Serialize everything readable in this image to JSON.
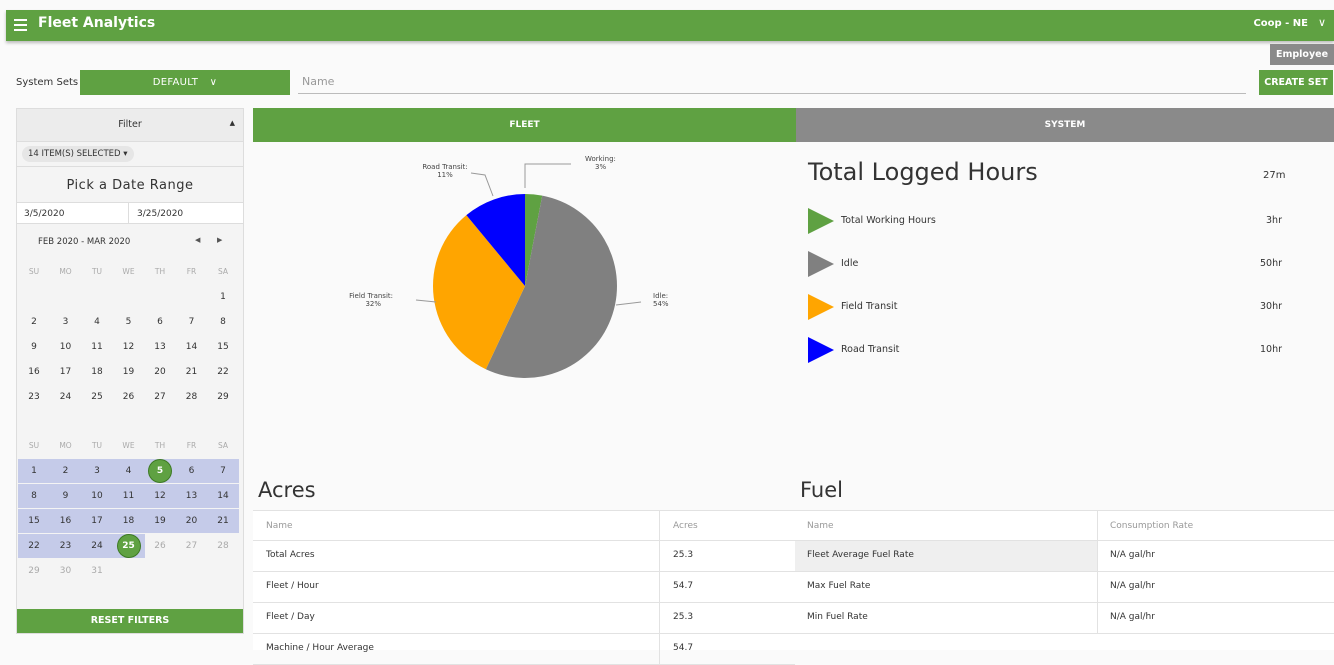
{
  "header": {
    "app_title": "Fleet Analytics",
    "org_name": "Coop - NE",
    "employee_badge": "Employee"
  },
  "toolbar": {
    "system_sets_label": "System Sets",
    "default_label": "DEFAULT",
    "name_placeholder": "Name",
    "create_set_label": "CREATE SET"
  },
  "filter": {
    "title": "Filter",
    "items_selected": "14 ITEM(S) SELECTED ▾",
    "date_range_title": "Pick a Date Range",
    "start_date": "3/5/2020",
    "end_date": "3/25/2020",
    "month_label": "FEB 2020 - MAR 2020",
    "weekdays": [
      "SU",
      "MO",
      "TU",
      "WE",
      "TH",
      "FR",
      "SA"
    ],
    "reset_label": "RESET FILTERS"
  },
  "tabs": {
    "fleet": "FLEET",
    "system": "SYSTEM"
  },
  "pie": {
    "slices": [
      {
        "name": "Working",
        "percent": 3,
        "label": "Working:",
        "value_label": "3%",
        "color": "#5fa142"
      },
      {
        "name": "Idle",
        "percent": 54,
        "label": "Idle:",
        "value_label": "54%",
        "color": "#808080"
      },
      {
        "name": "Field Transit",
        "percent": 32,
        "label": "Field Transit:",
        "value_label": "32%",
        "color": "#ffa500"
      },
      {
        "name": "Road Transit",
        "percent": 11,
        "label": "Road Transit:",
        "value_label": "11%",
        "color": "#0000ff"
      }
    ]
  },
  "summary": {
    "title": "Total Logged Hours",
    "total": "27m",
    "items": [
      {
        "label": "Total Working Hours",
        "value": "3hr",
        "color": "#5fa142"
      },
      {
        "label": "Idle",
        "value": "50hr",
        "color": "#808080"
      },
      {
        "label": "Field Transit",
        "value": "30hr",
        "color": "#ffa500"
      },
      {
        "label": "Road Transit",
        "value": "10hr",
        "color": "#0000ff"
      }
    ]
  },
  "acres": {
    "title": "Acres",
    "headers": [
      "Name",
      "Acres"
    ],
    "rows": [
      [
        "Total Acres",
        "25.3"
      ],
      [
        "Fleet / Hour",
        "54.7"
      ],
      [
        "Fleet / Day",
        "25.3"
      ],
      [
        "Machine / Hour Average",
        "54.7"
      ]
    ]
  },
  "fuel": {
    "title": "Fuel",
    "headers": [
      "Name",
      "Consumption Rate"
    ],
    "rows": [
      [
        "Fleet Average Fuel Rate",
        "N/A gal/hr"
      ],
      [
        "Max Fuel Rate",
        "N/A gal/hr"
      ],
      [
        "Min Fuel Rate",
        "N/A gal/hr"
      ]
    ]
  },
  "colors": {
    "accent": "#5fa142",
    "secondary": "#8a8a8a",
    "range_highlight": "#c5cbe9"
  }
}
